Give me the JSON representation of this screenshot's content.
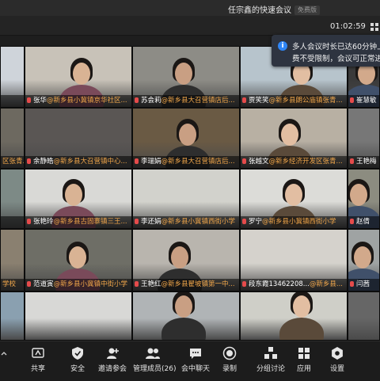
{
  "window": {
    "title": "任宗鑫的快速会议",
    "free_badge": "免费版",
    "timer": "01:02:59"
  },
  "notice": {
    "line1": "多人会议时长已达60分钟上",
    "line2": "费不受限制，会议可正常进"
  },
  "tiles": [
    {
      "name": "",
      "org": ""
    },
    {
      "name": "张华",
      "org": "@新乡县小冀镇京华社区..."
    },
    {
      "name": "苏会莉",
      "org": "@新乡县大召营镇店后..."
    },
    {
      "name": "贾笑笑",
      "org": "@新乡县朗公庙镇张青..."
    },
    {
      "name": "崔慧敏",
      "org": ""
    },
    {
      "name": "",
      "org": "区张青..."
    },
    {
      "name": "余静皓",
      "org": "@新乡县大召营镇中心..."
    },
    {
      "name": "李瑞娟",
      "org": "@新乡县大召营镇店后..."
    },
    {
      "name": "张越文",
      "org": "@新乡经济开发区张青..."
    },
    {
      "name": "王艳梅",
      "org": ""
    },
    {
      "name": "",
      "org": ""
    },
    {
      "name": "张艳玲",
      "org": "@新乡县古固寨镇三王..."
    },
    {
      "name": "李还娟",
      "org": "@新乡县小冀镇西街小学"
    },
    {
      "name": "罗宁",
      "org": "@新乡县小冀镇西街小学"
    },
    {
      "name": "赵倩",
      "org": ""
    },
    {
      "name": "",
      "org": "学校"
    },
    {
      "name": "范道寅",
      "org": "@新乡县小冀镇中街小学"
    },
    {
      "name": "王艳红",
      "org": "@新乡县翟坡镇第一中..."
    },
    {
      "name": "段东霞13462208...",
      "org": "@新乡县..."
    },
    {
      "name": "闫茜",
      "org": ""
    },
    {
      "name": "",
      "org": ""
    },
    {
      "name": "",
      "org": ""
    },
    {
      "name": "",
      "org": ""
    },
    {
      "name": "",
      "org": ""
    },
    {
      "name": "",
      "org": ""
    }
  ],
  "toolbar": {
    "share": "共享",
    "security": "安全",
    "invite": "邀请参会",
    "members": "管理成员(26)",
    "chat": "会中聊天",
    "record": "录制",
    "breakout": "分组讨论",
    "apps": "应用",
    "settings": "设置"
  },
  "icons": [
    "share-icon",
    "shield-icon",
    "invite-icon",
    "members-icon",
    "chat-icon",
    "record-icon",
    "breakout-icon",
    "apps-icon",
    "settings-icon",
    "grid-view-icon",
    "info-icon",
    "mic-muted-icon"
  ],
  "colors": {
    "org_text": "#f0a64a",
    "background": "#1e1e1e",
    "info_blue": "#2f86f6"
  }
}
